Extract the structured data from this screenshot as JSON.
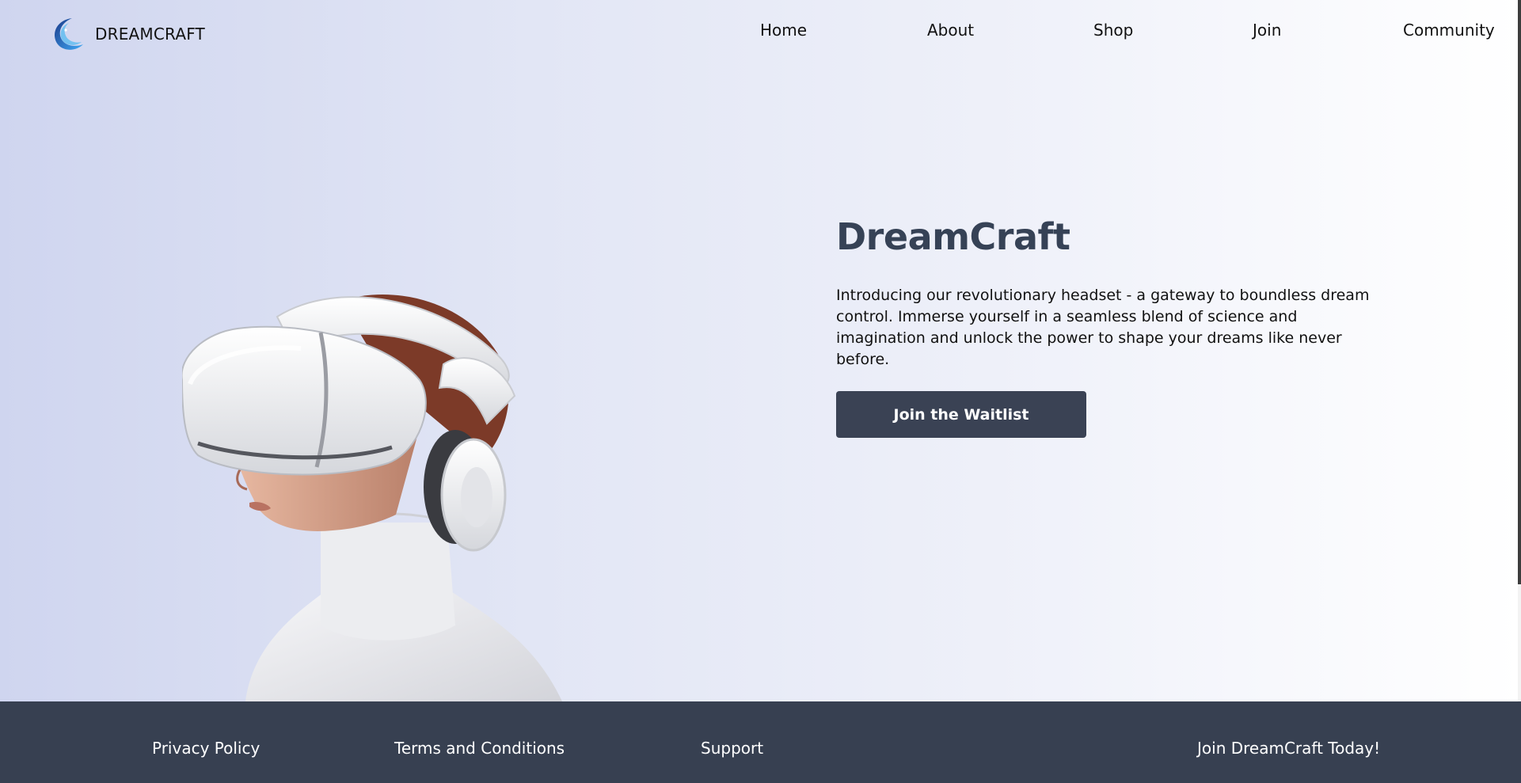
{
  "brand": {
    "name": "DREAMCRAFT",
    "logo_icon": "crescent-moon-logo-icon"
  },
  "nav": {
    "items": [
      {
        "label": "Home"
      },
      {
        "label": "About"
      },
      {
        "label": "Shop"
      },
      {
        "label": "Join"
      },
      {
        "label": "Community"
      }
    ]
  },
  "hero": {
    "title": "DreamCraft",
    "description": "Introducing our revolutionary headset - a gateway to boundless dream control. Immerse yourself in a seamless blend of science and imagination and unlock the power to shape your dreams like never before.",
    "cta_label": "Join the Waitlist",
    "image_subject": "woman-wearing-vr-headset"
  },
  "footer": {
    "links": [
      {
        "label": "Privacy Policy"
      },
      {
        "label": "Terms and Conditions"
      },
      {
        "label": "Support"
      },
      {
        "label": "Join DreamCraft Today!"
      }
    ]
  },
  "colors": {
    "accent_dark": "#364256",
    "button_bg": "#3a4254",
    "footer_bg": "#374051",
    "hero_gradient_start": "#cfd5ef",
    "hero_gradient_end": "#ffffff"
  }
}
